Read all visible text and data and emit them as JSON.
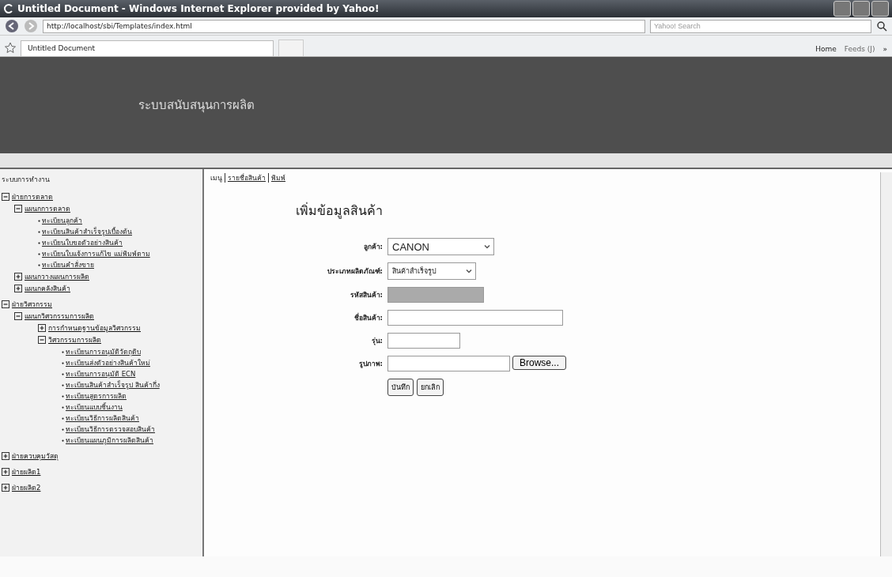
{
  "window": {
    "title": "Untitled Document - Windows Internet Explorer provided by Yahoo!"
  },
  "address_bar": {
    "url": "http://localhost/sbi/Templates/index.html",
    "search_placeholder": "Yahoo! Search"
  },
  "tabs": [
    {
      "label": "Untitled Document",
      "selected": true
    }
  ],
  "command_bar": {
    "home": "Home",
    "feeds": "Feeds (J)",
    "more": "»"
  },
  "header": {
    "title": "ระบบสนับสนุนการผลิต"
  },
  "sidebar": {
    "title": "ระบบการทำงาน",
    "tree": [
      {
        "kind": "group",
        "label": "ฝ่ายการตลาด",
        "expanded": true,
        "children": [
          {
            "kind": "group",
            "label": "แผนกการตลาด",
            "expanded": true,
            "children": [
              {
                "kind": "link",
                "label": "ทะเบียนลูกค้า"
              },
              {
                "kind": "link",
                "label": "ทะเบียนสินค้าสำเร็จรูปเบื้องต้น"
              },
              {
                "kind": "link",
                "label": "ทะเบียนใบขอตัวอย่างสินค้า"
              },
              {
                "kind": "link",
                "label": "ทะเบียนใบแจ้งการแก้ไข แม่พิมพ์ตาม"
              },
              {
                "kind": "link",
                "label": "ทะเบียนคำสั่งขาย"
              }
            ]
          },
          {
            "kind": "group",
            "label": "แผนกวางแผนการผลิต",
            "expanded": false
          },
          {
            "kind": "group",
            "label": "แผนกคลังสินค้า",
            "expanded": false
          }
        ]
      },
      {
        "kind": "group",
        "label": "ฝ่ายวิศวกรรม",
        "expanded": true,
        "children": [
          {
            "kind": "group",
            "label": "แผนกวิศวกรรมการผลิต",
            "expanded": true,
            "children": [
              {
                "kind": "group",
                "label": "การกำหนดฐานข้อมูลวิศวกรรม",
                "expanded": false
              },
              {
                "kind": "group",
                "label": "วิศวกรรมการผลิต",
                "expanded": true,
                "children": [
                  {
                    "kind": "link",
                    "label": "ทะเบียนการอนุมัติวัตถุดิบ"
                  },
                  {
                    "kind": "link",
                    "label": "ทะเบียนส่งตัวอย่างสินค้าใหม่"
                  },
                  {
                    "kind": "link",
                    "label": "ทะเบียนการอนุมัติ ECN"
                  },
                  {
                    "kind": "link",
                    "label": "ทะเบียนสินค้าสำเร็จรูป สินค้ากึ่ง"
                  },
                  {
                    "kind": "link",
                    "label": "ทะเบียนสูตรการผลิต"
                  },
                  {
                    "kind": "link",
                    "label": "ทะเบียนแบบชิ้นงาน"
                  },
                  {
                    "kind": "link",
                    "label": "ทะเบียนวิธีการผลิตสินค้า"
                  },
                  {
                    "kind": "link",
                    "label": "ทะเบียนวิธีการตรวจสอบสินค้า"
                  },
                  {
                    "kind": "link",
                    "label": "ทะเบียนแผนภูมิการผลิตสินค้า"
                  }
                ]
              }
            ]
          }
        ]
      },
      {
        "kind": "group",
        "label": "ฝ่ายควบคุมวัสดุ",
        "expanded": false
      },
      {
        "kind": "group",
        "label": "ฝ่ายผลิต1",
        "expanded": false
      },
      {
        "kind": "group",
        "label": "ฝ่ายผลิต2",
        "expanded": false
      }
    ]
  },
  "menu": [
    {
      "label": "เมนู",
      "kind": "text"
    },
    {
      "label": "รายชื่อสินค้า",
      "kind": "link"
    },
    {
      "label": "พิมพ์",
      "kind": "link"
    }
  ],
  "form": {
    "title": "เพิ่มข้อมูลสินค้า",
    "fields": [
      {
        "kind": "select",
        "label": "ลูกค้า:",
        "value": "CANON"
      },
      {
        "kind": "select",
        "label": "ประเภทผลิตภัณฑ์:",
        "value": "สินค้าสำเร็จรูป"
      },
      {
        "kind": "text",
        "label": "รหัสสินค้า:",
        "disabled": true
      },
      {
        "kind": "text",
        "label": "ชื่อสินค้า:",
        "disabled": false
      },
      {
        "kind": "short",
        "label": "รุ่น:",
        "disabled": false
      },
      {
        "kind": "file",
        "label": "รูปภาพ:",
        "button": "Browse..."
      }
    ],
    "buttons": [
      "บันทึก",
      "ยกเลิก"
    ]
  }
}
